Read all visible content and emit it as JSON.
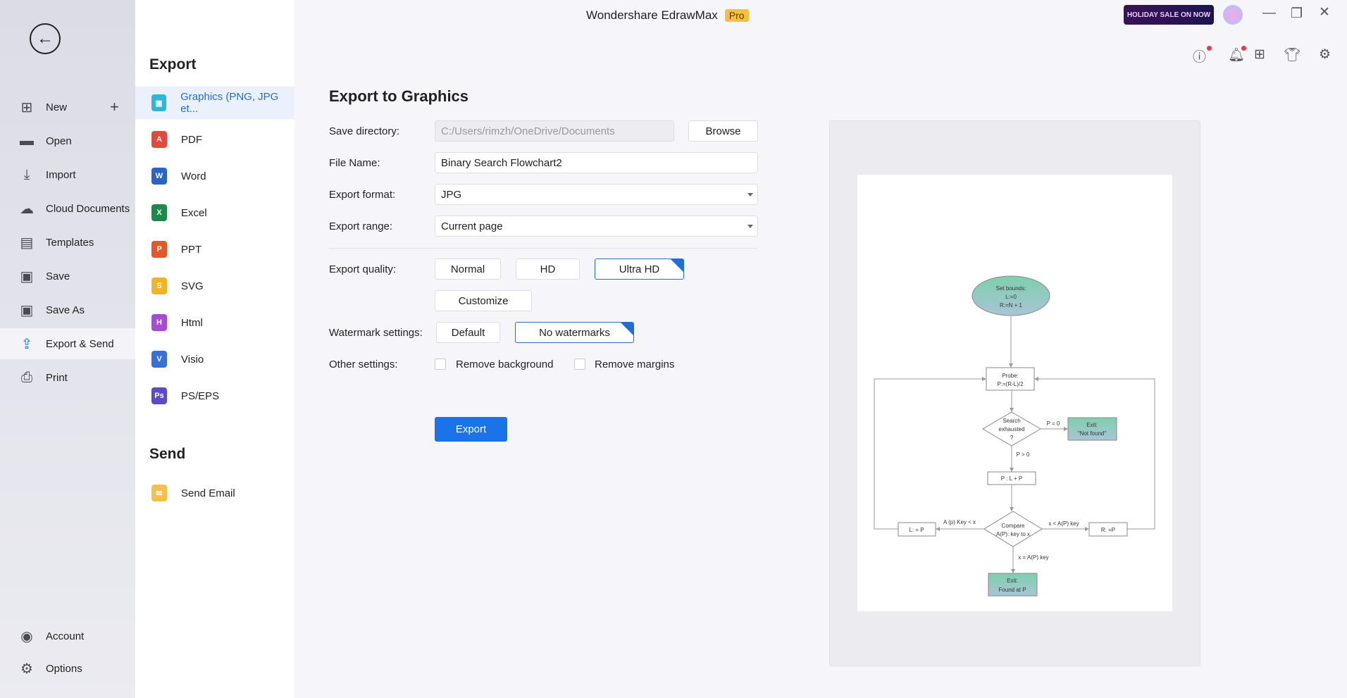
{
  "app": {
    "title": "Wondershare EdrawMax",
    "badge": "Pro",
    "sale_banner": "HOLIDAY SALE ON NOW"
  },
  "sidebar": {
    "items": [
      {
        "label": "New",
        "icon": "plus-square-icon"
      },
      {
        "label": "Open",
        "icon": "folder-icon"
      },
      {
        "label": "Import",
        "icon": "import-icon"
      },
      {
        "label": "Cloud Documents",
        "icon": "cloud-icon"
      },
      {
        "label": "Templates",
        "icon": "templates-icon"
      },
      {
        "label": "Save",
        "icon": "save-icon"
      },
      {
        "label": "Save As",
        "icon": "save-as-icon"
      },
      {
        "label": "Export & Send",
        "icon": "export-icon",
        "selected": true
      },
      {
        "label": "Print",
        "icon": "print-icon"
      }
    ],
    "bottom": [
      {
        "label": "Account",
        "icon": "account-icon"
      },
      {
        "label": "Options",
        "icon": "gear-icon"
      }
    ]
  },
  "export_menu": {
    "heading": "Export",
    "items": [
      {
        "label": "Graphics (PNG, JPG et...",
        "badge": "▣",
        "color": "#2fb5d8",
        "selected": true
      },
      {
        "label": "PDF",
        "badge": "A",
        "color": "#e5483d"
      },
      {
        "label": "Word",
        "badge": "W",
        "color": "#2b63c6"
      },
      {
        "label": "Excel",
        "badge": "X",
        "color": "#1d8a4b"
      },
      {
        "label": "PPT",
        "badge": "P",
        "color": "#e1582c"
      },
      {
        "label": "SVG",
        "badge": "S",
        "color": "#f0b429"
      },
      {
        "label": "Html",
        "badge": "H",
        "color": "#a64bd6"
      },
      {
        "label": "Visio",
        "badge": "V",
        "color": "#3a6fd8"
      },
      {
        "label": "PS/EPS",
        "badge": "Ps",
        "color": "#5b4bc4"
      }
    ],
    "send_heading": "Send",
    "send_items": [
      {
        "label": "Send Email",
        "color": "#f3c14b"
      }
    ]
  },
  "form": {
    "title": "Export to Graphics",
    "save_directory_label": "Save directory:",
    "save_directory": "C:/Users/rimzh/OneDrive/Documents",
    "browse": "Browse",
    "file_name_label": "File Name:",
    "file_name": "Binary Search Flowchart2",
    "format_label": "Export format:",
    "format": "JPG",
    "range_label": "Export range:",
    "range": "Current page",
    "quality_label": "Export quality:",
    "quality_options": [
      "Normal",
      "HD",
      "Ultra HD"
    ],
    "quality_selected": "Ultra HD",
    "customize": "Customize",
    "watermark_label": "Watermark settings:",
    "watermark_options": [
      "Default",
      "No watermarks"
    ],
    "watermark_selected": "No watermarks",
    "other_label": "Other settings:",
    "remove_background": "Remove background",
    "remove_margins": "Remove margins",
    "remove_background_checked": false,
    "remove_margins_checked": false,
    "export": "Export"
  },
  "flowchart": {
    "start": [
      "Set bounds:",
      "L:=0",
      "R:=N + 1"
    ],
    "probe": [
      "Probe:",
      "P:=(R-L)/2"
    ],
    "decision1": [
      "Search",
      "exhausted",
      "?"
    ],
    "p_zero": "P = 0",
    "exit_not_found": [
      "Exit:",
      "\"Not found\""
    ],
    "p_gt_zero": "P > 0",
    "step": "P : L + P",
    "decision2": [
      "Compare",
      "A(P): key to x"
    ],
    "left_label": "A (p) Key < x",
    "left_box": "L: = P",
    "right_label": "x < A(P) key",
    "right_box": "R: =P",
    "down_label": "x = A(P) key",
    "exit_found": [
      "Exit:",
      "Found at P"
    ]
  },
  "colors": {
    "accent": "#1f6fd6",
    "terminal_fill": "#8fc9b0"
  }
}
